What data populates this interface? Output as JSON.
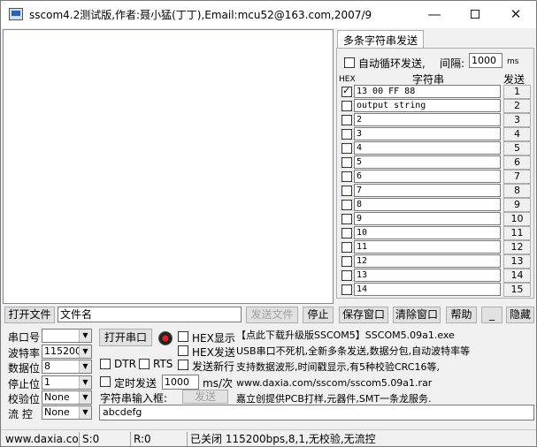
{
  "window": {
    "title": "sscom4.2测试版,作者:聂小猛(丁丁),Email:mcu52@163.com,2007/9",
    "minimize": "—",
    "close": "✕"
  },
  "multi": {
    "tab_label": "多条字符串发送",
    "auto_loop_label": "自动循环发送,",
    "auto_loop_checked": false,
    "interval_label": "间隔:",
    "interval_value": "1000",
    "interval_unit": "ms",
    "header_hex": "HEX",
    "header_string": "字符串",
    "header_send": "发送",
    "rows": [
      {
        "checked": true,
        "text": "13 00 FF 88",
        "button": "1"
      },
      {
        "checked": false,
        "text": "output string",
        "button": "2"
      },
      {
        "checked": false,
        "text": "2",
        "button": "3"
      },
      {
        "checked": false,
        "text": "3",
        "button": "4"
      },
      {
        "checked": false,
        "text": "4",
        "button": "5"
      },
      {
        "checked": false,
        "text": "5",
        "button": "6"
      },
      {
        "checked": false,
        "text": "6",
        "button": "7"
      },
      {
        "checked": false,
        "text": "7",
        "button": "8"
      },
      {
        "checked": false,
        "text": "8",
        "button": "9"
      },
      {
        "checked": false,
        "text": "9",
        "button": "10"
      },
      {
        "checked": false,
        "text": "10",
        "button": "11"
      },
      {
        "checked": false,
        "text": "11",
        "button": "12"
      },
      {
        "checked": false,
        "text": "12",
        "button": "13"
      },
      {
        "checked": false,
        "text": "13",
        "button": "14"
      },
      {
        "checked": false,
        "text": "14",
        "button": "15"
      }
    ]
  },
  "toolbar": {
    "open_file": "打开文件",
    "file_name": "文件名",
    "send_file": "发送文件",
    "stop": "停止",
    "save_window": "保存窗口",
    "clear_window": "清除窗口",
    "help": "帮助",
    "minus": "_",
    "hide": "隐藏"
  },
  "settings": {
    "port_label": "串口号",
    "port_value": "",
    "baud_label": "波特率",
    "baud_value": "115200",
    "data_label": "数据位",
    "data_value": "8",
    "stop_label": "停止位",
    "stop_value": "1",
    "parity_label": "校验位",
    "parity_value": "None",
    "flow_label": "流 控",
    "flow_value": "None",
    "open_port": "打开串口",
    "hex_display": "HEX显示",
    "hex_send": "HEX发送",
    "dtr": "DTR",
    "rts": "RTS",
    "send_newline": "发送新行",
    "timed_send": "定时发送",
    "timed_value": "1000",
    "timed_unit": "ms/次",
    "string_input_label": "字符串输入框:",
    "send_button": "发送",
    "send_text": "abcdefg"
  },
  "info": {
    "line1": "【点此下载升级版SSCOM5】SSCOM5.09a1.exe",
    "line2": "USB串口不死机,全新多条发送,数据分包,自动波特率等",
    "line3": "支持数据波形,时间戳显示,有5种校验CRC16等,",
    "line4": "www.daxia.com/sscom/sscom5.09a1.rar",
    "line5": "嘉立创提供PCB打样,元器件,SMT一条龙服务."
  },
  "status": {
    "site": "www.daxia.com",
    "sent": "S:0",
    "received": "R:0",
    "state": "已关闭  115200bps,8,1,无校验,无流控"
  }
}
